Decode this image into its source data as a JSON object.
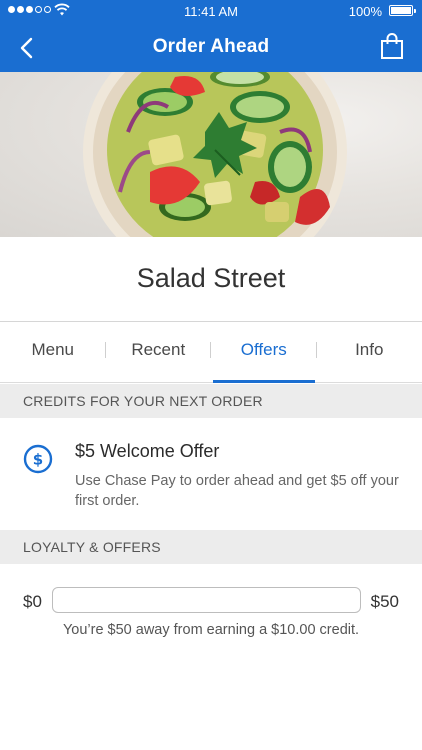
{
  "status_bar": {
    "time": "11:41 AM",
    "battery": "100%",
    "signal_dots": 5,
    "signal_filled": 3
  },
  "nav": {
    "title": "Order Ahead",
    "back_icon": "chevron-left-icon",
    "bag_icon": "shopping-bag-icon"
  },
  "restaurant": {
    "name": "Salad Street"
  },
  "tabs": [
    {
      "label": "Menu",
      "active": false
    },
    {
      "label": "Recent",
      "active": false
    },
    {
      "label": "Offers",
      "active": true
    },
    {
      "label": "Info",
      "active": false
    }
  ],
  "credits": {
    "section_title": "CREDITS FOR YOUR NEXT ORDER",
    "offer_title": "$5 Welcome Offer",
    "offer_description": "Use Chase Pay to order ahead and get $5 off your first order.",
    "offer_icon": "dollar-circle-icon"
  },
  "loyalty": {
    "section_title": "LOYALTY & OFFERS",
    "min_label": "$0",
    "max_label": "$50",
    "progress_fraction": 0,
    "progress_text": "You’re $50 away from earning a $10.00 credit."
  },
  "colors": {
    "primary": "#1a6ed1",
    "section_bg": "#ececec"
  }
}
